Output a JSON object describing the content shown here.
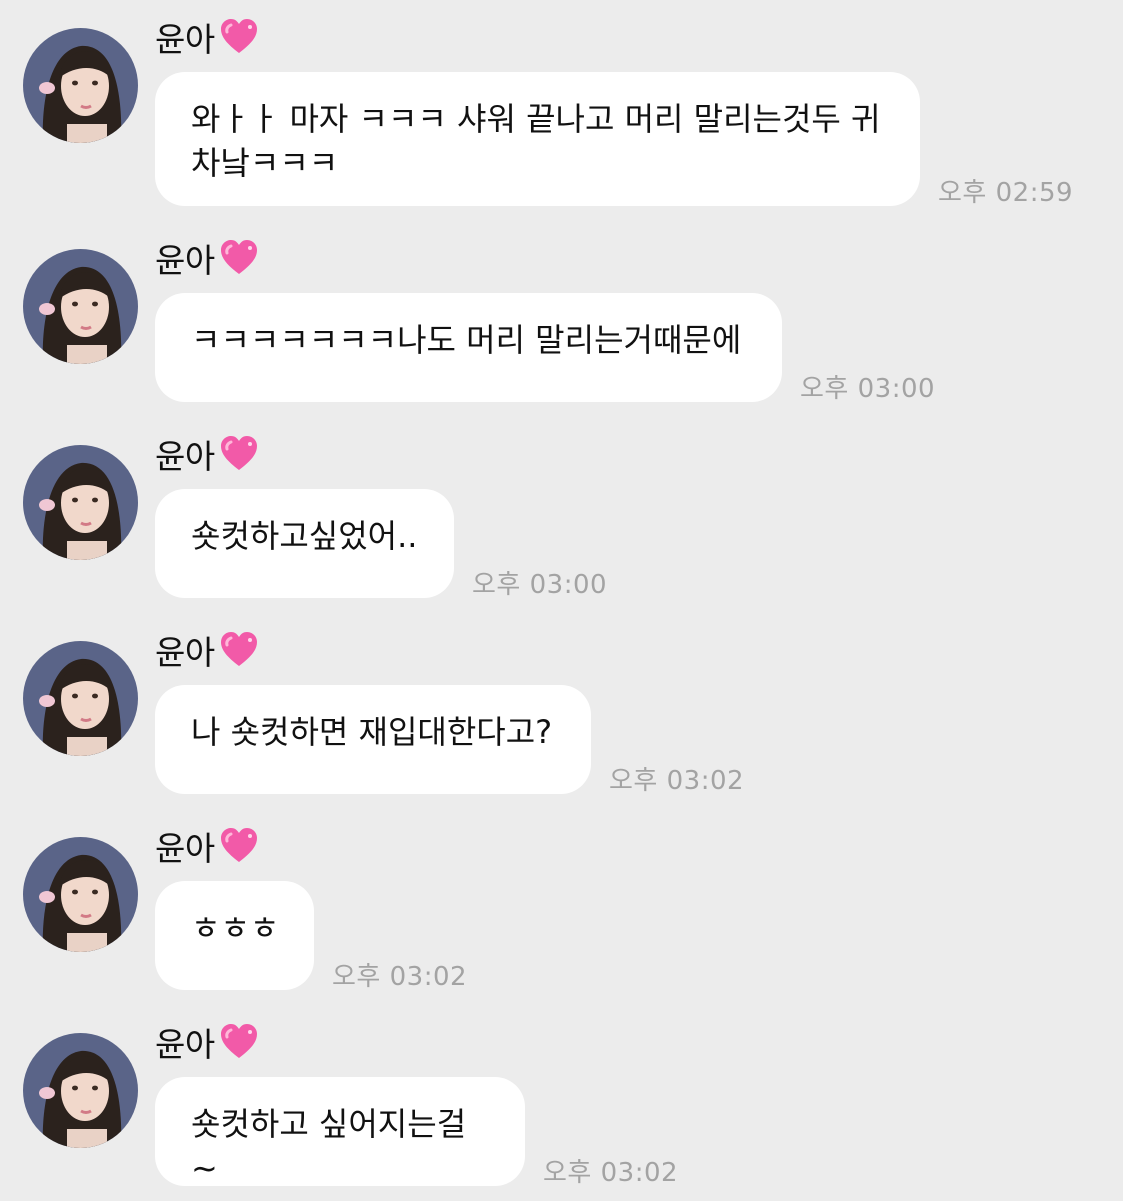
{
  "chat": {
    "messages": [
      {
        "sender": "윤아",
        "text": "와ㅏㅏ 마자 ㅋㅋㅋ 샤워 끝나고 머리 말리는것두 귀\n차낰ㅋㅋㅋ",
        "time": "오후 02:59"
      },
      {
        "sender": "윤아",
        "text": "ㅋㅋㅋㅋㅋㅋㅋ나도 머리 말리는거때문에",
        "time": "오후 03:00"
      },
      {
        "sender": "윤아",
        "text": "숏컷하고싶었어..",
        "time": "오후 03:00"
      },
      {
        "sender": "윤아",
        "text": "나 숏컷하면 재입대한다고?",
        "time": "오후 03:02"
      },
      {
        "sender": "윤아",
        "text": "ㅎㅎㅎ",
        "time": "오후 03:02"
      },
      {
        "sender": "윤아",
        "text": "숏컷하고 싶어지는걸~",
        "time": "오후 03:02"
      }
    ]
  },
  "icons": {
    "name_badge": "pink-sparkling-heart-icon",
    "avatar": "profile-photo"
  },
  "colors": {
    "background": "#ececec",
    "bubble": "#ffffff",
    "timestamp": "#a3a3a3",
    "heart": "#f25aa8"
  }
}
